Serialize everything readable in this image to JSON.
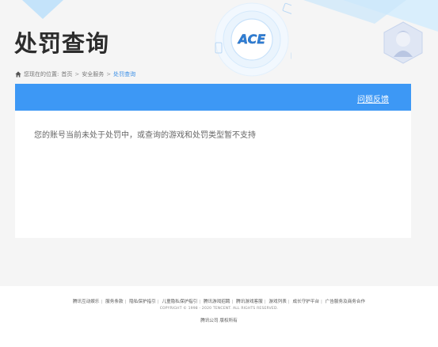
{
  "header": {
    "title": "处罚查询"
  },
  "breadcrumb": {
    "prefix": "您现在的位置:",
    "items": [
      "首页",
      "安全服务",
      "处罚查询"
    ],
    "separator": ">"
  },
  "card": {
    "feedback_label": "问题反馈",
    "message": "您的账号当前未处于处罚中，或查询的游戏和处罚类型暂不支持"
  },
  "footer": {
    "links": [
      "腾讯互动娱乐",
      "服务条款",
      "隐私保护指引",
      "儿童隐私保护指引",
      "腾讯游戏招聘",
      "腾讯游戏客服",
      "游戏列表",
      "成长守护平台",
      "广告服务及商务合作"
    ],
    "copyright": "COPYRIGHT © 1998 - 2020 TENCENT. ALL RIGHTS RESERVED.",
    "rights": "腾讯公司 版权所有"
  },
  "emblem": {
    "text": "ACE"
  },
  "colors": {
    "accent": "#3d98f5",
    "breadcrumb_current": "#3a8ee6"
  }
}
